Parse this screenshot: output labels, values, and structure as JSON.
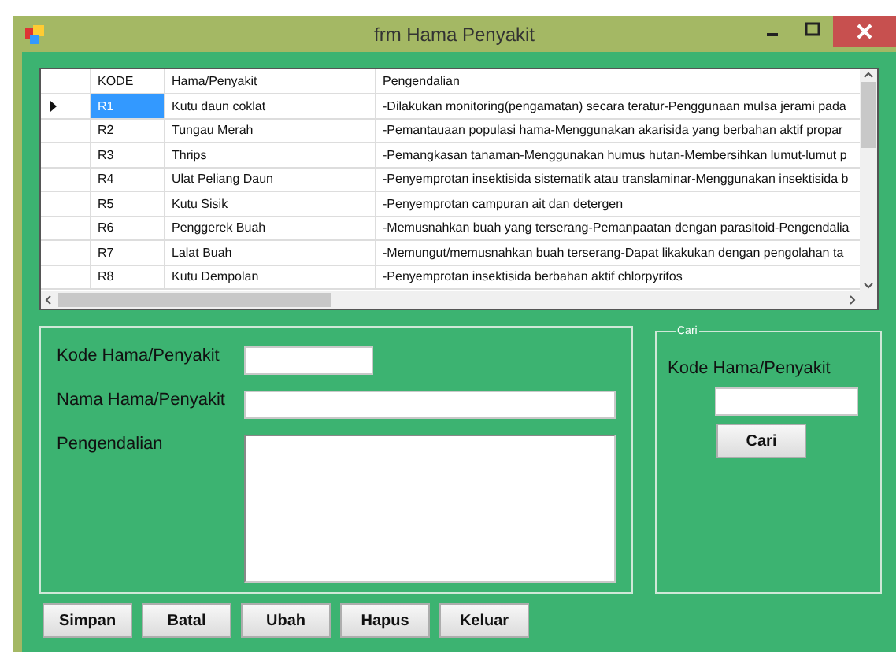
{
  "window": {
    "title": "frm Hama Penyakit"
  },
  "table": {
    "columns": [
      "KODE",
      "Hama/Penyakit",
      "Pengendalian"
    ],
    "rows": [
      {
        "selected": true,
        "cells": [
          "R1",
          "Kutu daun coklat",
          "-Dilakukan monitoring(pengamatan) secara teratur-Penggunaan mulsa jerami pada"
        ]
      },
      {
        "selected": false,
        "cells": [
          "R2",
          "Tungau Merah",
          "-Pemantauaan populasi hama-Menggunakan akarisida yang berbahan aktif propar"
        ]
      },
      {
        "selected": false,
        "cells": [
          "R3",
          "Thrips",
          "-Pemangkasan tanaman-Menggunakan humus hutan-Membersihkan lumut-lumut p"
        ]
      },
      {
        "selected": false,
        "cells": [
          "R4",
          "Ulat Peliang Daun",
          "-Penyemprotan insektisida sistematik atau translaminar-Menggunakan insektisida b"
        ]
      },
      {
        "selected": false,
        "cells": [
          "R5",
          "Kutu Sisik",
          "-Penyemprotan campuran ait dan detergen"
        ]
      },
      {
        "selected": false,
        "cells": [
          "R6",
          "Penggerek Buah",
          "-Memusnahkan buah yang terserang-Pemanpaatan dengan parasitoid-Pengendalia"
        ]
      },
      {
        "selected": false,
        "cells": [
          "R7",
          "Lalat Buah",
          "-Memungut/memusnahkan buah terserang-Dapat likakukan dengan pengolahan ta"
        ]
      },
      {
        "selected": false,
        "cells": [
          "R8",
          "Kutu Dempolan",
          "-Penyemprotan insektisida berbahan aktif chlorpyrifos"
        ]
      }
    ]
  },
  "form": {
    "fields": [
      {
        "kind": "short",
        "label": "Kode Hama/Penyakit"
      },
      {
        "kind": "long",
        "label": "Nama Hama/Penyakit"
      },
      {
        "kind": "multiline",
        "label": "Pengendalian"
      }
    ]
  },
  "search": {
    "group_title": "Cari",
    "label": "Kode Hama/Penyakit",
    "button": "Cari"
  },
  "buttons": [
    "Simpan",
    "Batal",
    "Ubah",
    "Hapus",
    "Keluar"
  ]
}
